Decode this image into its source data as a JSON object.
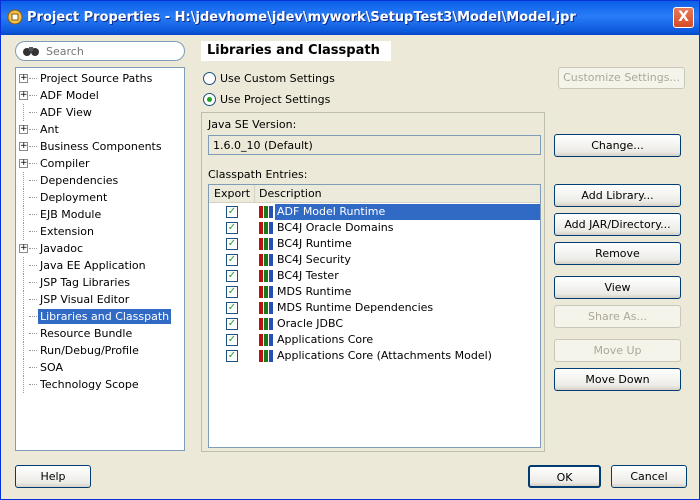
{
  "window": {
    "title": "Project Properties - H:\\jdevhome\\jdev\\mywork\\SetupTest3\\Model\\Model.jpr",
    "close": "X"
  },
  "search": {
    "placeholder": "Search"
  },
  "tree": {
    "items": [
      {
        "label": "Project Source Paths",
        "expandable": true
      },
      {
        "label": "ADF Model",
        "expandable": true
      },
      {
        "label": "ADF View",
        "expandable": false
      },
      {
        "label": "Ant",
        "expandable": true
      },
      {
        "label": "Business Components",
        "expandable": true
      },
      {
        "label": "Compiler",
        "expandable": true
      },
      {
        "label": "Dependencies",
        "expandable": false
      },
      {
        "label": "Deployment",
        "expandable": false
      },
      {
        "label": "EJB Module",
        "expandable": false
      },
      {
        "label": "Extension",
        "expandable": false
      },
      {
        "label": "Javadoc",
        "expandable": true
      },
      {
        "label": "Java EE Application",
        "expandable": false
      },
      {
        "label": "JSP Tag Libraries",
        "expandable": false
      },
      {
        "label": "JSP Visual Editor",
        "expandable": false
      },
      {
        "label": "Libraries and Classpath",
        "expandable": false,
        "selected": true
      },
      {
        "label": "Resource Bundle",
        "expandable": false
      },
      {
        "label": "Run/Debug/Profile",
        "expandable": false
      },
      {
        "label": "SOA",
        "expandable": false
      },
      {
        "label": "Technology Scope",
        "expandable": false
      }
    ]
  },
  "panel": {
    "header": "Libraries and Classpath",
    "use_custom": "Use Custom Settings",
    "use_project": "Use Project Settings",
    "customize": "Customize Settings...",
    "java_se_label": "Java SE Version:",
    "java_se_value": "1.6.0_10 (Default)",
    "change": "Change...",
    "classpath_label": "Classpath Entries:",
    "col_export": "Export",
    "col_description": "Description",
    "entries": [
      {
        "name": "ADF Model Runtime",
        "exported": true,
        "selected": true
      },
      {
        "name": "BC4J Oracle Domains",
        "exported": true
      },
      {
        "name": "BC4J Runtime",
        "exported": true
      },
      {
        "name": "BC4J Security",
        "exported": true
      },
      {
        "name": "BC4J Tester",
        "exported": true
      },
      {
        "name": "MDS Runtime",
        "exported": true
      },
      {
        "name": "MDS Runtime Dependencies",
        "exported": true
      },
      {
        "name": "Oracle JDBC",
        "exported": true
      },
      {
        "name": "Applications Core",
        "exported": true
      },
      {
        "name": "Applications Core (Attachments Model)",
        "exported": true
      }
    ],
    "add_library": "Add Library...",
    "add_jar": "Add JAR/Directory...",
    "remove": "Remove",
    "view": "View",
    "share_as": "Share As...",
    "move_up": "Move Up",
    "move_down": "Move Down"
  },
  "footer": {
    "help": "Help",
    "ok": "OK",
    "cancel": "Cancel"
  },
  "colors": {
    "selection": "#316ac5",
    "titlebar": "#0a5fe6",
    "dialog_bg": "#ece9d8"
  }
}
